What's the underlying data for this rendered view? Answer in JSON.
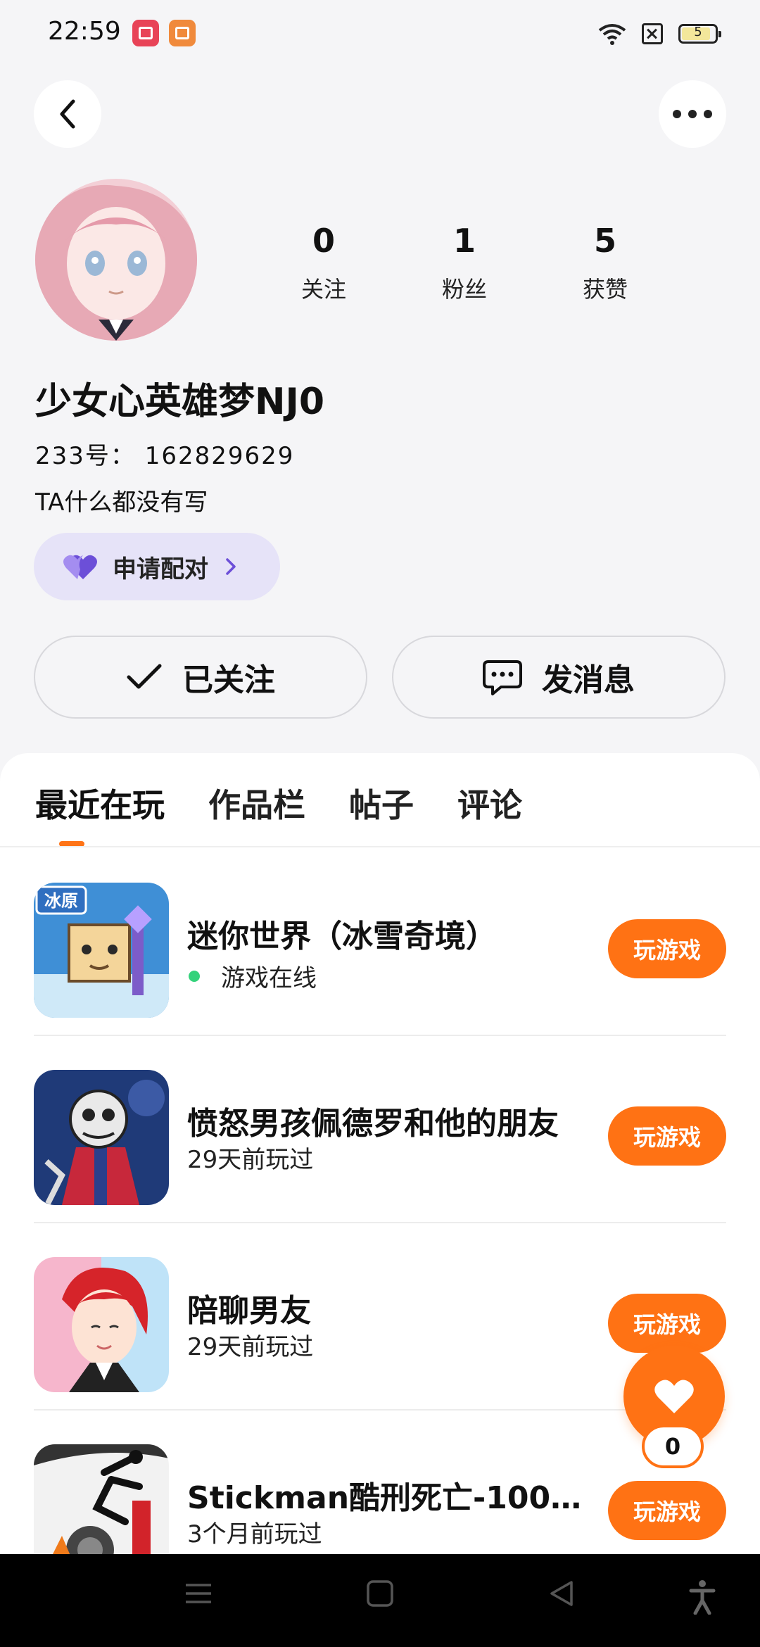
{
  "status_bar": {
    "time": "22:59",
    "battery_level": "5",
    "icons": [
      "screen-record-icon",
      "reader-icon",
      "wifi-icon",
      "no-sim-icon",
      "battery-icon"
    ]
  },
  "profile": {
    "nickname": "少女心英雄梦NJ0",
    "user_id": "233号：  162829629",
    "bio": "TA什么都没有写",
    "stats": [
      {
        "value": "0",
        "label": "关注"
      },
      {
        "value": "1",
        "label": "粉丝"
      },
      {
        "value": "5",
        "label": "获赞"
      }
    ],
    "match_button": "申请配对",
    "followed_button": "已关注",
    "message_button": "发消息"
  },
  "tabs": [
    {
      "label": "最近在玩",
      "active": true
    },
    {
      "label": "作品栏",
      "active": false
    },
    {
      "label": "帖子",
      "active": false
    },
    {
      "label": "评论",
      "active": false
    }
  ],
  "games": [
    {
      "name": "迷你世界（冰雪奇境）",
      "status": "游戏在线",
      "online": true,
      "play_label": "玩游戏",
      "icon_text": "冰原"
    },
    {
      "name": "愤怒男孩佩德罗和他的朋友",
      "status": "29天前玩过",
      "online": false,
      "play_label": "玩游戏"
    },
    {
      "name": "陪聊男友",
      "status": "29天前玩过",
      "online": false,
      "play_label": "玩游戏"
    },
    {
      "name": "Stickman酷刑死亡-100种…",
      "status": "3个月前玩过",
      "online": false,
      "play_label": "玩游戏"
    }
  ],
  "like": {
    "count": "0"
  },
  "colors": {
    "accent": "#ff7214",
    "match_bg": "#e6e3f8",
    "heart": "#7a5be0",
    "online": "#34d27b"
  }
}
